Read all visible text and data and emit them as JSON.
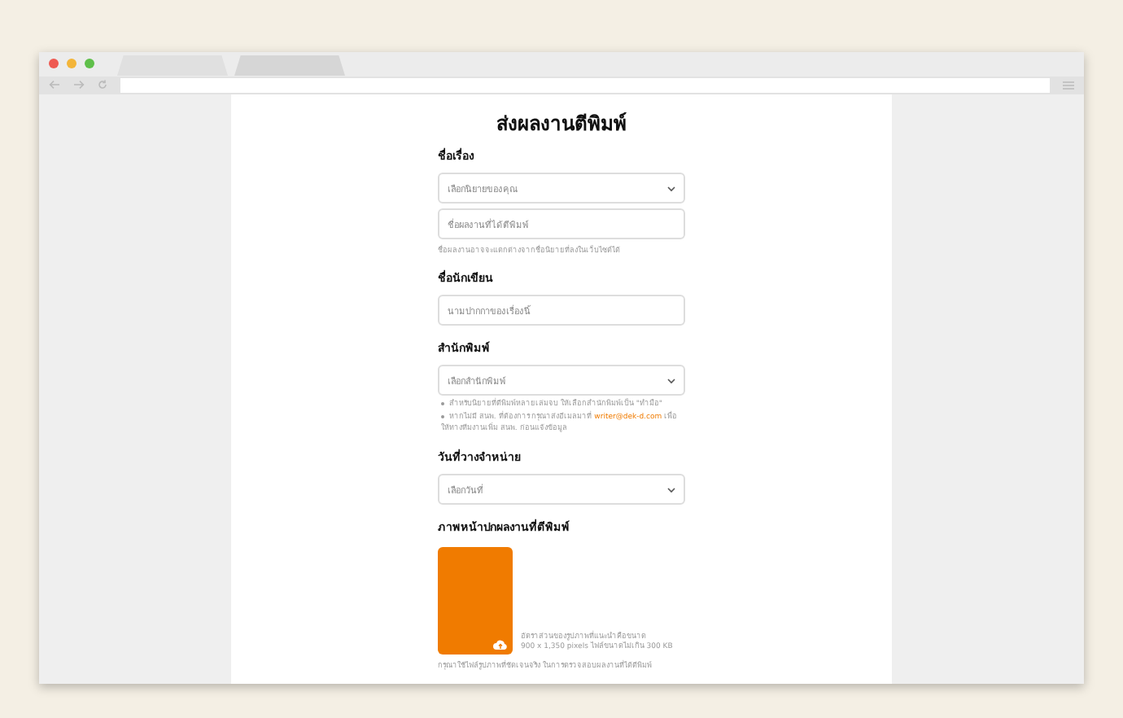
{
  "page_title": "ส่งผลงานตีพิมพ์",
  "sections": [
    {
      "label": "ชื่อเรื่อง",
      "controls": [
        {
          "kind": "select",
          "placeholder": "เลือกนิยายของคุณ"
        },
        {
          "kind": "input",
          "placeholder": "ชื่อผลงานที่ได้ตีพิมพ์"
        }
      ],
      "hint": "ชื่อผลงานอาจจะแตกต่างจากชื่อนิยายที่ลงในเว็บไซต์ได้"
    },
    {
      "label": "ชื่อนักเขียน",
      "controls": [
        {
          "kind": "input",
          "placeholder": "นามปากกาของเรื่องนี้"
        }
      ]
    },
    {
      "label": "สำนักพิมพ์",
      "controls": [
        {
          "kind": "select",
          "placeholder": "เลือกสำนักพิมพ์"
        }
      ],
      "bullets": [
        {
          "text": "สำหรับนิยายที่ตีพิมพ์หลายเล่มจบ ให้เลือกสำนักพิมพ์เป็น \"ทำมือ\""
        },
        {
          "text": "หากไม่มี สนพ. ที่ต้องการ กรุณาส่งอีเมลมาที่",
          "link": "writer@dek-d.com",
          "after": "เพื่อให้ทางทีมงานเพิ่ม สนพ. ก่อนแจ้งข้อมูล"
        }
      ]
    },
    {
      "label": "วันที่วางจำหน่าย",
      "controls": [
        {
          "kind": "select",
          "placeholder": "เลือกวันที่"
        }
      ]
    }
  ],
  "cover": {
    "label": "ภาพหน้าปกผลงานที่ตีพิมพ์",
    "spec_lines": [
      "อัตราส่วนของรูปภาพที่แนะนำคือขนาด",
      "900 x 1,350 pixels ไฟล์ขนาดไม่เกิน 300 KB"
    ],
    "note": "กรุณาใช้ไฟล์รูปภาพที่ชัดเจนจริง ในการตรวจสอบผลงานที่ได้ตีพิมพ์"
  }
}
